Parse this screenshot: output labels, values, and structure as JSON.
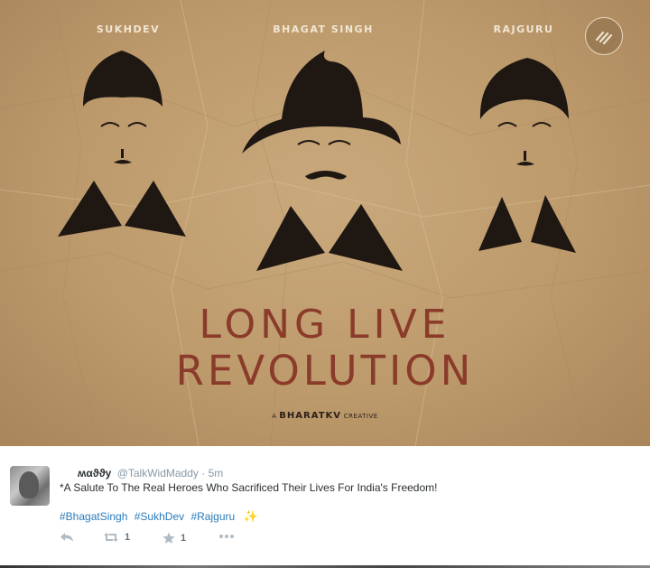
{
  "poster": {
    "names": [
      "SUKHDEV",
      "BHAGAT SINGH",
      "RAJGURU"
    ],
    "headline_line1": "LONG LIVE",
    "headline_line2": "REVOLUTION",
    "credit_prefix": "A",
    "credit_brand": "BHARATKV",
    "credit_suffix": "CREATIVE",
    "logo_icon": "chevron-logo-icon",
    "colors": {
      "paper": "#bd9a6c",
      "headline": "#8a3b2a",
      "silhouette": "#1e1712"
    }
  },
  "tweet": {
    "display_name": "ʍαϑϑу",
    "handle": "@TalkWidMaddy",
    "separator": "·",
    "time": "5m",
    "text": "*A Salute To The Real Heroes Who Sacrificed Their Lives For India's Freedom!",
    "hashtags": [
      "#BhagatSingh",
      "#SukhDev",
      "#Rajguru"
    ],
    "sparkle": "✨",
    "retweet_count": "1",
    "favorite_count": "1",
    "icons": [
      "reply-icon",
      "retweet-icon",
      "star-icon",
      "more-icon"
    ],
    "colors": {
      "link": "#2b7bb9",
      "meta": "#8899a6",
      "text": "#292f33"
    }
  }
}
